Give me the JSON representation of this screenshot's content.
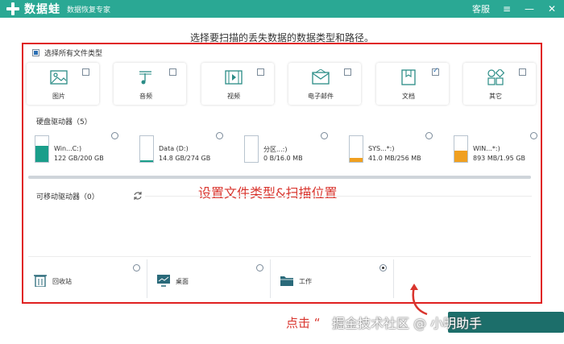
{
  "titlebar": {
    "app_name": "数据蛙",
    "subtitle": "数据恢复专家",
    "support": "客服",
    "menu_glyph": "≡",
    "minimize_glyph": "—",
    "close_glyph": "✕"
  },
  "heading": "选择要扫描的丢失数据的数据类型和路径。",
  "select_all_label": "选择所有文件类型",
  "file_types": [
    {
      "label": "图片",
      "checked": false
    },
    {
      "label": "音频",
      "checked": false
    },
    {
      "label": "视频",
      "checked": false
    },
    {
      "label": "电子邮件",
      "checked": false
    },
    {
      "label": "文档",
      "checked": true
    },
    {
      "label": "其它",
      "checked": false
    }
  ],
  "hard_drives_label": "硬盘驱动器（5）",
  "drives": [
    {
      "name": "Win...C:)",
      "size": "122 GB/200 GB",
      "used_fraction": 0.61,
      "color": "#1a9e8a"
    },
    {
      "name": "Data (D:)",
      "size": "14.8 GB/274 GB",
      "used_fraction": 0.05,
      "color": "#1a9e8a"
    },
    {
      "name": "分区...:)",
      "size": "0 B/16.0 MB",
      "used_fraction": 0.0,
      "color": "#f0a020"
    },
    {
      "name": "SYS...*:)",
      "size": "41.0 MB/256 MB",
      "used_fraction": 0.16,
      "color": "#f0a020"
    },
    {
      "name": "WIN...*:)",
      "size": "893 MB/1.95 GB",
      "used_fraction": 0.45,
      "color": "#f0a020"
    }
  ],
  "removable_label": "可移动驱动器（0）",
  "overlay_caption": "设置文件类型&扫描位置",
  "locations": [
    {
      "label": "回收站",
      "selected": false
    },
    {
      "label": "桌面",
      "selected": false
    },
    {
      "label": "工作",
      "selected": true
    }
  ],
  "annotation": "点击 “",
  "watermark": "掘金技术社区 @ 小明助手",
  "colors": {
    "titlebar": "#2aa894",
    "highlight": "#e02020",
    "accent": "#1a9e8a"
  }
}
